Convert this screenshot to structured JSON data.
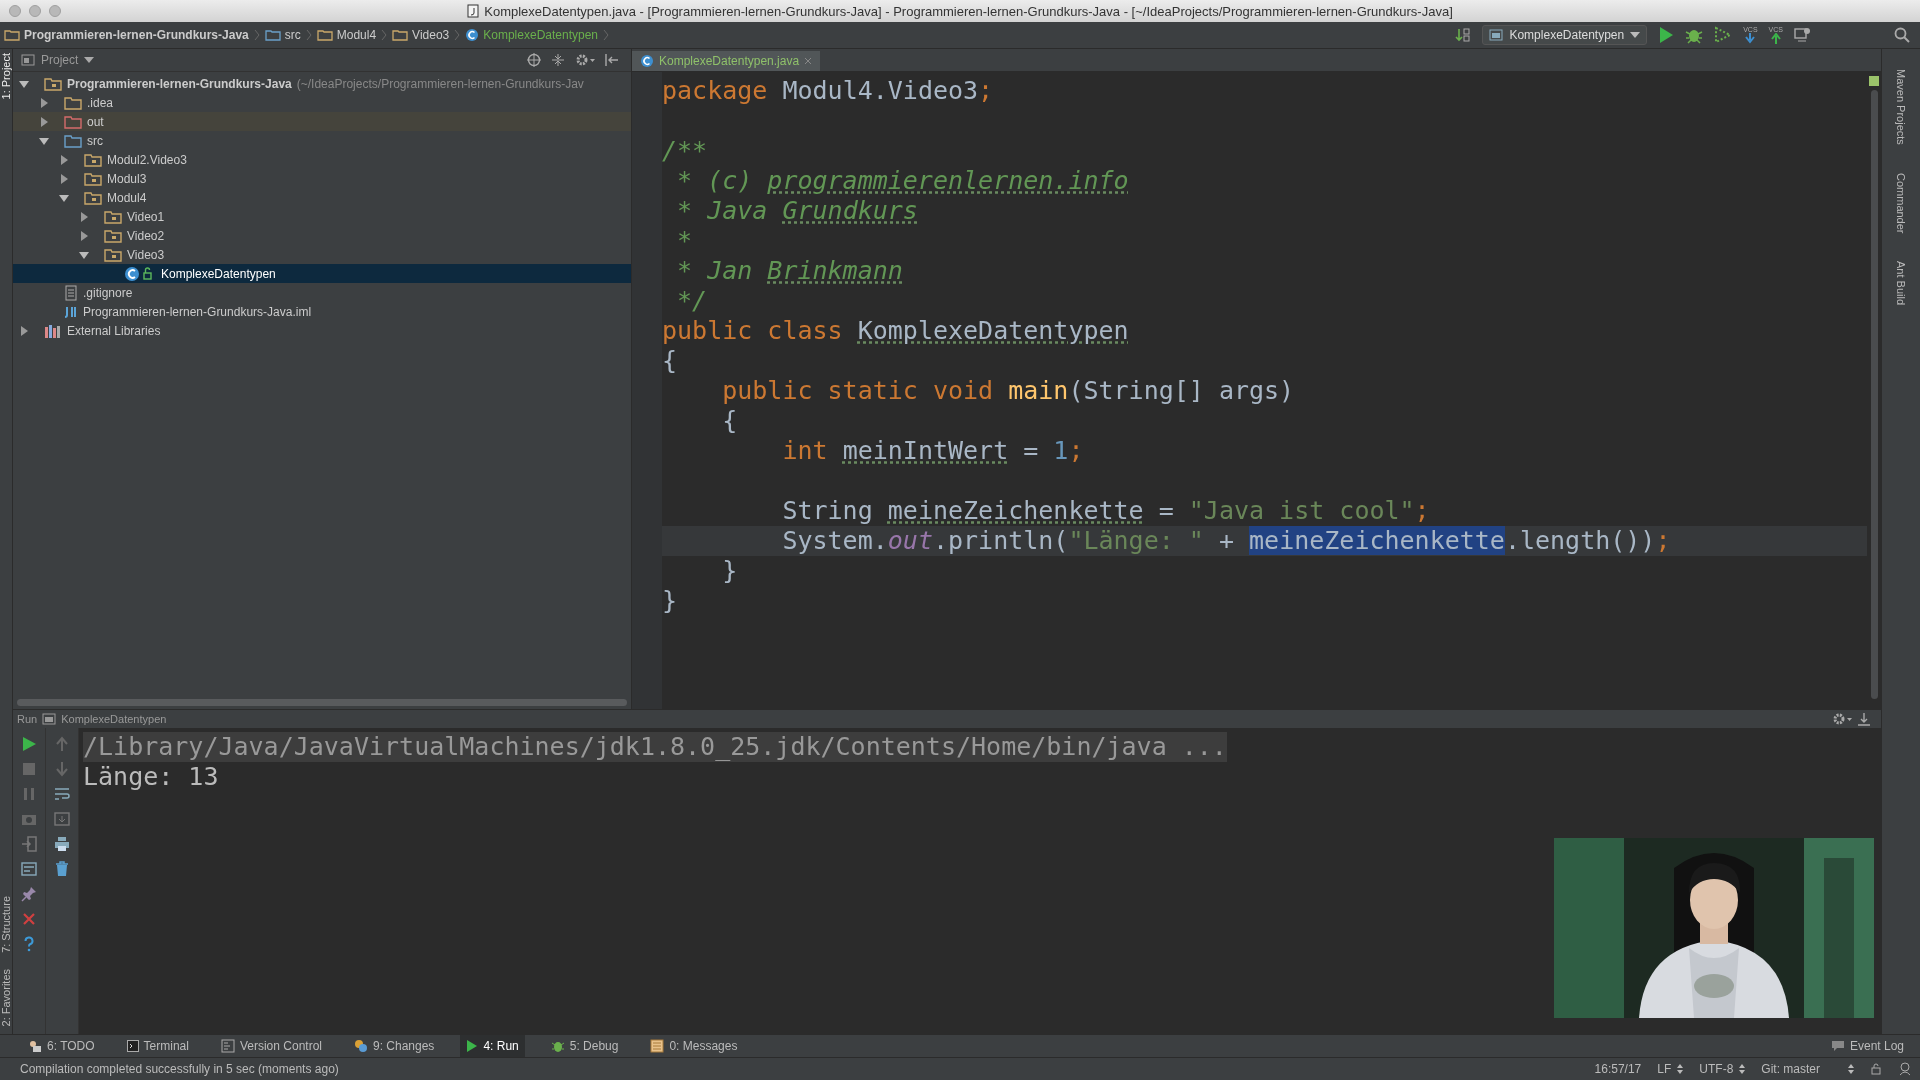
{
  "window": {
    "title": "KomplexeDatentypen.java - [Programmieren-lernen-Grundkurs-Java] - Programmieren-lernen-Grundkurs-Java - [~/IdeaProjects/Programmieren-lernen-Grundkurs-Java]"
  },
  "breadcrumbs": [
    {
      "label": "Programmieren-lernen-Grundkurs-Java",
      "kind": "project"
    },
    {
      "label": "src",
      "kind": "source"
    },
    {
      "label": "Modul4",
      "kind": "package"
    },
    {
      "label": "Video3",
      "kind": "package"
    },
    {
      "label": "KomplexeDatentypen",
      "kind": "class"
    }
  ],
  "toolbar": {
    "run_config": "KomplexeDatentypen",
    "vcs_labels": [
      "VCS",
      "VCS"
    ]
  },
  "side_tabs_left": [
    "1: Project",
    "7: Structure",
    "2: Favorites"
  ],
  "side_tabs_right": [
    "Maven Projects",
    "Commander",
    "Ant Build"
  ],
  "project_panel": {
    "title": "Project",
    "tree": [
      {
        "label": "Programmieren-lernen-Grundkurs-Java",
        "note": "(~/IdeaProjects/Programmieren-lernen-Grundkurs-Jav",
        "kind": "project",
        "expanded": true,
        "selected": false,
        "children": [
          {
            "label": ".idea",
            "kind": "folder",
            "expanded": false,
            "selected": false
          },
          {
            "label": "out",
            "kind": "excluded",
            "expanded": false,
            "selected": false
          },
          {
            "label": "src",
            "kind": "source",
            "expanded": true,
            "selected": false,
            "children": [
              {
                "label": "Modul2.Video3",
                "kind": "package",
                "expanded": false,
                "selected": false
              },
              {
                "label": "Modul3",
                "kind": "package",
                "expanded": false,
                "selected": false
              },
              {
                "label": "Modul4",
                "kind": "package",
                "expanded": true,
                "selected": false,
                "children": [
                  {
                    "label": "Video1",
                    "kind": "package",
                    "expanded": false,
                    "selected": false
                  },
                  {
                    "label": "Video2",
                    "kind": "package",
                    "expanded": false,
                    "selected": false
                  },
                  {
                    "label": "Video3",
                    "kind": "package",
                    "expanded": true,
                    "selected": false,
                    "children": [
                      {
                        "label": "KomplexeDatentypen",
                        "kind": "class",
                        "selected": true
                      }
                    ]
                  }
                ]
              }
            ]
          },
          {
            "label": ".gitignore",
            "kind": "file",
            "selected": false
          },
          {
            "label": "Programmieren-lernen-Grundkurs-Java.iml",
            "kind": "module",
            "selected": false
          }
        ]
      },
      {
        "label": "External Libraries",
        "kind": "library",
        "expanded": false,
        "selected": false
      }
    ]
  },
  "editor": {
    "tabs": [
      {
        "label": "KomplexeDatentypen.java",
        "selected": true
      }
    ],
    "lines": [
      {
        "current": false,
        "tokens": [
          {
            "kind": "kw",
            "text": "package "
          },
          {
            "kind": "plain",
            "text": "Modul4.Video3"
          },
          {
            "kind": "kw",
            "text": ";"
          }
        ]
      },
      {
        "current": false
      },
      {
        "current": false,
        "tokens": [
          {
            "kind": "doc",
            "text": "/**"
          }
        ]
      },
      {
        "current": false,
        "tokens": [
          {
            "kind": "doc",
            "text": " * (c) "
          },
          {
            "kind": "doc_typo",
            "text": "programmierenlernen.info"
          }
        ]
      },
      {
        "current": false,
        "tokens": [
          {
            "kind": "doc",
            "text": " * Java "
          },
          {
            "kind": "doc_typo",
            "text": "Grundkurs"
          }
        ]
      },
      {
        "current": false,
        "tokens": [
          {
            "kind": "doc",
            "text": " *"
          }
        ]
      },
      {
        "current": false,
        "tokens": [
          {
            "kind": "doc",
            "text": " * Jan "
          },
          {
            "kind": "doc_typo",
            "text": "Brinkmann"
          }
        ]
      },
      {
        "current": false,
        "tokens": [
          {
            "kind": "doc",
            "text": " */"
          }
        ]
      },
      {
        "current": false,
        "tokens": [
          {
            "kind": "kw",
            "text": "public class "
          },
          {
            "kind": "typo",
            "text": "KomplexeDatentypen"
          }
        ]
      },
      {
        "current": false,
        "tokens": [
          {
            "kind": "plain",
            "text": "{"
          }
        ]
      },
      {
        "current": false,
        "tokens": [
          {
            "kind": "kw",
            "text": "    public static void "
          },
          {
            "kind": "method",
            "text": "main"
          },
          {
            "kind": "plain",
            "text": "(String[] args)"
          }
        ]
      },
      {
        "current": false,
        "tokens": [
          {
            "kind": "plain",
            "text": "    {"
          }
        ]
      },
      {
        "current": false,
        "tokens": [
          {
            "kind": "kw",
            "text": "        int "
          },
          {
            "kind": "typo",
            "text": "meinIntWert"
          },
          {
            "kind": "plain",
            "text": " = "
          },
          {
            "kind": "num",
            "text": "1"
          },
          {
            "kind": "kw",
            "text": ";"
          }
        ]
      },
      {
        "current": false
      },
      {
        "current": false,
        "tokens": [
          {
            "kind": "plain",
            "text": "        String "
          },
          {
            "kind": "typo",
            "text": "meineZeichenkette"
          },
          {
            "kind": "plain",
            "text": " = "
          },
          {
            "kind": "str",
            "text": "\"Java ist cool\""
          },
          {
            "kind": "kw",
            "text": ";"
          }
        ]
      },
      {
        "current": true,
        "tokens": [
          {
            "kind": "plain",
            "text": "        System."
          },
          {
            "kind": "field",
            "text": "out"
          },
          {
            "kind": "plain",
            "text": ".println("
          },
          {
            "kind": "str",
            "text": "\"Länge: \""
          },
          {
            "kind": "plain",
            "text": " + "
          },
          {
            "kind": "selected",
            "text": "meineZeichenkette"
          },
          {
            "kind": "plain",
            "text": ".length())"
          },
          {
            "kind": "kw",
            "text": ";"
          }
        ]
      },
      {
        "current": false,
        "tokens": [
          {
            "kind": "plain",
            "text": "    }"
          }
        ]
      },
      {
        "current": false,
        "tokens": [
          {
            "kind": "plain",
            "text": "}"
          }
        ]
      }
    ]
  },
  "run_panel": {
    "title": "Run",
    "config": "KomplexeDatentypen",
    "output": [
      {
        "kind": "command",
        "text": "/Library/Java/JavaVirtualMachines/jdk1.8.0_25.jdk/Contents/Home/bin/java ..."
      },
      {
        "kind": "stdout",
        "text": "Länge: 13"
      }
    ]
  },
  "tool_windows": [
    {
      "label": "6: TODO",
      "kind": "todo",
      "selected": false
    },
    {
      "label": "Terminal",
      "kind": "terminal",
      "selected": false
    },
    {
      "label": "Version Control",
      "kind": "vcs",
      "selected": false
    },
    {
      "label": "9: Changes",
      "kind": "changes",
      "selected": false
    },
    {
      "label": "4: Run",
      "kind": "run",
      "selected": true
    },
    {
      "label": "5: Debug",
      "kind": "debug",
      "selected": false
    },
    {
      "label": "0: Messages",
      "kind": "messages",
      "selected": false
    }
  ],
  "event_log": "Event Log",
  "status_bar": {
    "message": "Compilation completed successfully in 5 sec (moments ago)",
    "position": "16:57/17",
    "line_separator": "LF",
    "encoding": "UTF-8",
    "vcs": "Git: master"
  }
}
